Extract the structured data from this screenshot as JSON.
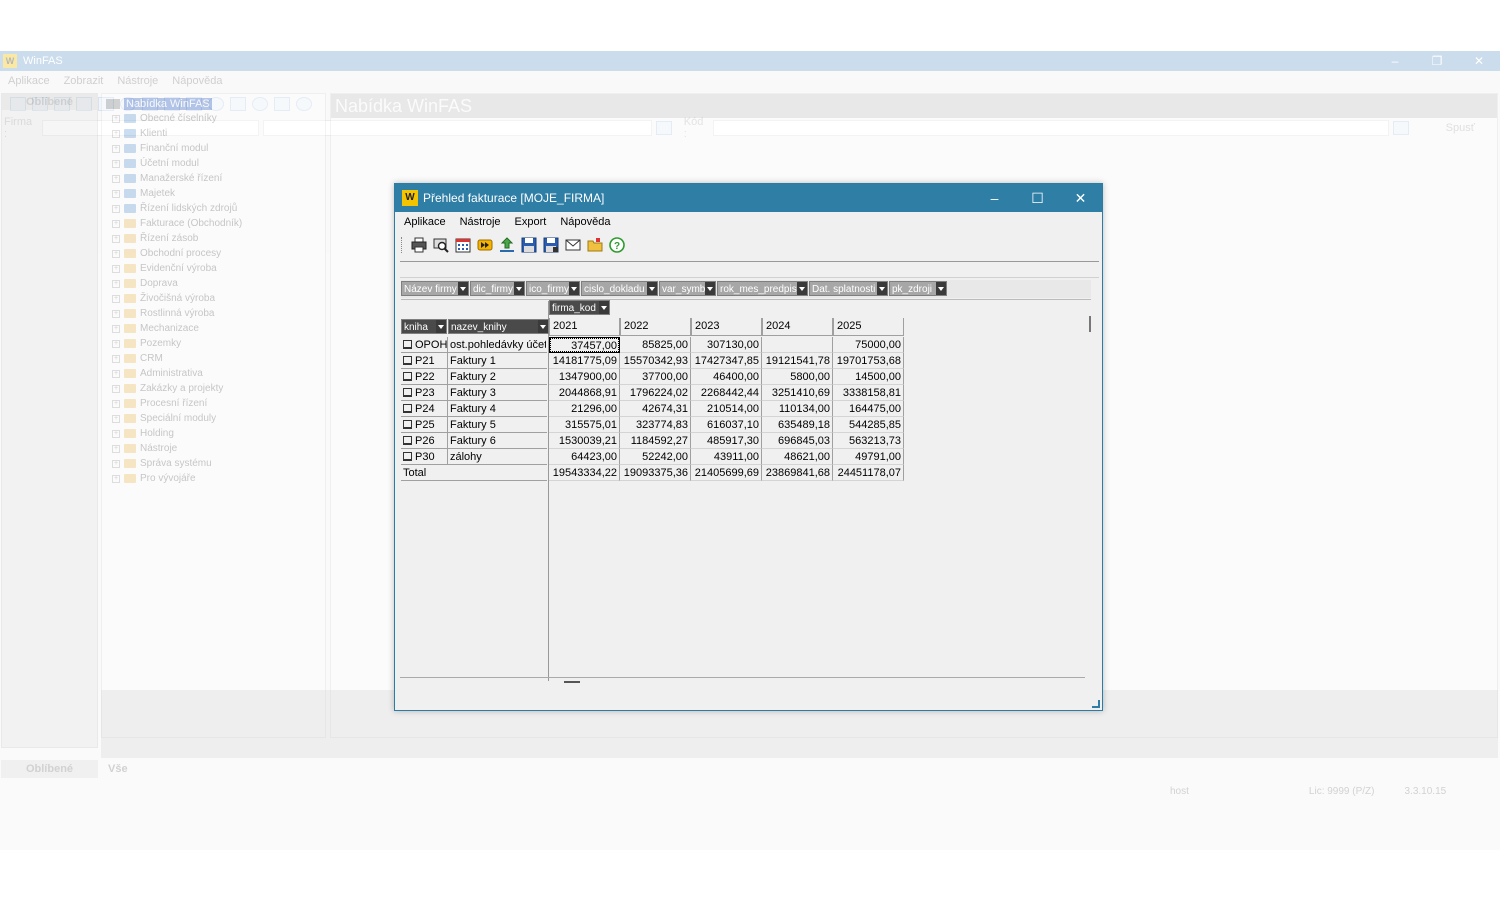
{
  "main": {
    "title": "WinFAS",
    "menu": [
      "Aplikace",
      "Zobrazit",
      "Nástroje",
      "Nápověda"
    ],
    "filter": {
      "firma_label": "Firma :",
      "kod_label": "Kód :",
      "run_button": "Spusť"
    },
    "left_tab": "Oblíbené",
    "tree_root": "Nabídka WinFAS",
    "tree_items": [
      "Obecné číselníky",
      "Klienti",
      "Finanční modul",
      "Účetní modul",
      "Manažerské řízení",
      "Majetek",
      "Řízení lidských zdrojů",
      "Fakturace (Obchodník)",
      "Řízení zásob",
      "Obchodní procesy",
      "Evidenční výroba",
      "Doprava",
      "Živočišná výroba",
      "Rostlinná výroba",
      "Mechanizace",
      "Pozemky",
      "CRM",
      "Administrativa",
      "Zakázky a projekty",
      "Procesní řízení",
      "Speciální moduly",
      "Holding",
      "Nástroje",
      "Správa systému",
      "Pro vývojáře"
    ],
    "content_title": "Nabídka WinFAS",
    "bottom_tabs": [
      "Oblíbené",
      "Vše"
    ],
    "status": {
      "user": "host",
      "license": "Lic: 9999 (P/Z)",
      "version": "3.3.10.15"
    }
  },
  "dialog": {
    "title": "Přehled fakturace [MOJE_FIRMA]",
    "menu": [
      "Aplikace",
      "Nástroje",
      "Export",
      "Nápověda"
    ],
    "toolbar_icons": [
      "print-icon",
      "print-preview-icon",
      "calendar-grid-icon",
      "forward-icon",
      "upload-icon",
      "save-icon",
      "save-as-icon",
      "mail-icon",
      "folder-icon",
      "help-icon"
    ],
    "filter_fields": [
      "Název firmy",
      "dic_firmy",
      "ico_firmy",
      "cislo_dokladu",
      "var_symb",
      "rok_mes_predpis",
      "Dat. splatnosti",
      "pk_zdroji"
    ],
    "column_field": "firma_kod",
    "row_fields": [
      "kniha",
      "nazev_knihy"
    ],
    "columns": [
      "2021",
      "2022",
      "2023",
      "2024",
      "2025"
    ],
    "rows": [
      {
        "kniha": "OPOH",
        "nazev": "ost.pohledávky účetn",
        "values": [
          "37457,00",
          "85825,00",
          "307130,00",
          "",
          "75000,00"
        ]
      },
      {
        "kniha": "P21",
        "nazev": "Faktury 1",
        "values": [
          "14181775,09",
          "15570342,93",
          "17427347,85",
          "19121541,78",
          "19701753,68"
        ]
      },
      {
        "kniha": "P22",
        "nazev": "Faktury 2",
        "values": [
          "1347900,00",
          "37700,00",
          "46400,00",
          "5800,00",
          "14500,00"
        ]
      },
      {
        "kniha": "P23",
        "nazev": "Faktury 3",
        "values": [
          "2044868,91",
          "1796224,02",
          "2268442,44",
          "3251410,69",
          "3338158,81"
        ]
      },
      {
        "kniha": "P24",
        "nazev": "Faktury 4",
        "values": [
          "21296,00",
          "42674,31",
          "210514,00",
          "110134,00",
          "164475,00"
        ]
      },
      {
        "kniha": "P25",
        "nazev": "Faktury 5",
        "values": [
          "315575,01",
          "323774,83",
          "616037,10",
          "635489,18",
          "544285,85"
        ]
      },
      {
        "kniha": "P26",
        "nazev": "Faktury 6",
        "values": [
          "1530039,21",
          "1184592,27",
          "485917,30",
          "696845,03",
          "563213,73"
        ]
      },
      {
        "kniha": "P30",
        "nazev": "zálohy",
        "values": [
          "64423,00",
          "52242,00",
          "43911,00",
          "48621,00",
          "49791,00"
        ]
      }
    ],
    "total": {
      "label": "Total",
      "values": [
        "19543334,22",
        "19093375,36",
        "21405699,69",
        "23869841,68",
        "24451178,07"
      ]
    }
  }
}
